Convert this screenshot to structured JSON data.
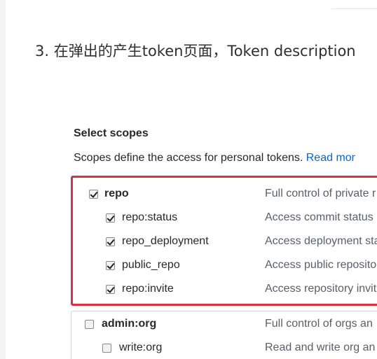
{
  "article": {
    "step_text": "3. 在弹出的产生token页面，Token description"
  },
  "scopes": {
    "heading": "Select scopes",
    "description": "Scopes define the access for personal tokens. ",
    "read_more_link": "Read mor"
  },
  "repo_group": {
    "parent": {
      "name": "repo",
      "description": "Full control of private r",
      "checked": true
    },
    "children": [
      {
        "name": "repo:status",
        "description": "Access commit status",
        "checked": true
      },
      {
        "name": "repo_deployment",
        "description": "Access deployment sta",
        "checked": true
      },
      {
        "name": "public_repo",
        "description": "Access public reposito",
        "checked": true
      },
      {
        "name": "repo:invite",
        "description": "Access repository invit",
        "checked": true
      }
    ]
  },
  "admin_org_group": {
    "parent": {
      "name": "admin:org",
      "description": "Full control of orgs an",
      "checked": false
    },
    "children": [
      {
        "name": "write:org",
        "description": "Read and write org an",
        "checked": false
      }
    ]
  },
  "colors": {
    "highlight_border": "#d7323e",
    "link": "#0366d6"
  }
}
